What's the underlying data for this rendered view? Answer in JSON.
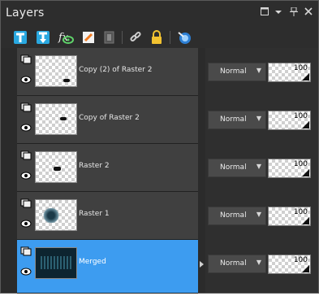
{
  "panel": {
    "title": "Layers"
  },
  "title_buttons": [
    "maximize-icon",
    "dropdown-icon",
    "pin-icon",
    "close-icon"
  ],
  "toolbar": {
    "tools": [
      "new-raster-layer-icon",
      "new-vector-layer-icon",
      "new-adjustment-layer-icon",
      "delete-layer-icon",
      "promote-layer-icon",
      "link-icon",
      "lock-icon",
      "layer-visibility-icon"
    ]
  },
  "layers": [
    {
      "name": "Copy (2) of Raster 2",
      "blend": "Normal",
      "opacity": "100",
      "selected": false
    },
    {
      "name": "Copy of Raster 2",
      "blend": "Normal",
      "opacity": "100",
      "selected": false
    },
    {
      "name": "Raster 2",
      "blend": "Normal",
      "opacity": "100",
      "selected": false
    },
    {
      "name": "Raster 1",
      "blend": "Normal",
      "opacity": "100",
      "selected": false
    },
    {
      "name": "Merged",
      "blend": "Normal",
      "opacity": "100",
      "selected": true
    }
  ],
  "colors": {
    "accent": "#3d9cf0",
    "panel_bg": "#404040",
    "title_bg": "#2d2d2d"
  }
}
